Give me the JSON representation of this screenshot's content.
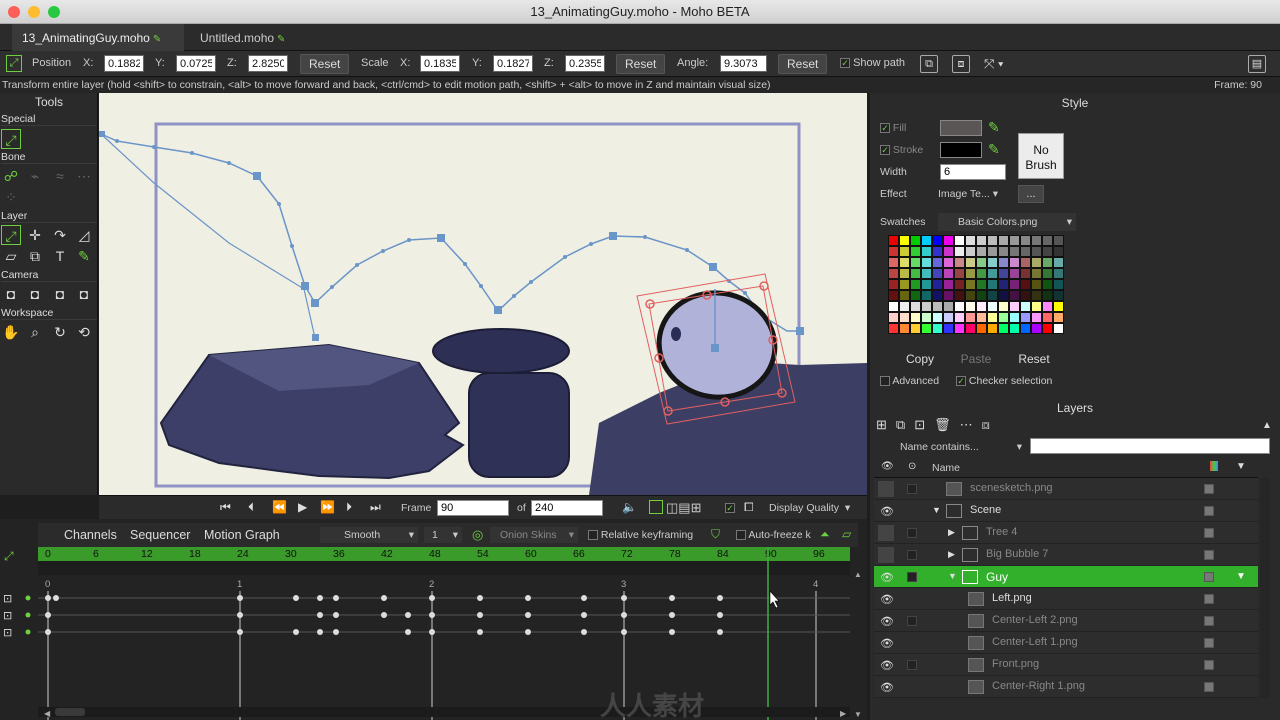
{
  "window": {
    "title": "13_AnimatingGuy.moho - Moho BETA"
  },
  "doc_tabs": [
    {
      "label": "13_AnimatingGuy.moho",
      "active": true
    },
    {
      "label": "Untitled.moho",
      "active": false
    }
  ],
  "options": {
    "position_label": "Position",
    "x_label": "X:",
    "y_label": "Y:",
    "z_label": "Z:",
    "pos_x": "0.1882",
    "pos_y": "0.0725",
    "pos_z": "2.8250",
    "reset_label": "Reset",
    "scale_label": "Scale",
    "scale_x": "0.1835",
    "scale_y": "0.1827",
    "scale_z": "0.2355",
    "angle_label": "Angle:",
    "angle": "9.3073",
    "show_path_label": "Show path"
  },
  "status": {
    "message": "Transform entire layer (hold <shift> to constrain, <alt> to move forward and back, <ctrl/cmd> to edit motion path, <shift> + <alt> to move in Z and maintain visual size)",
    "frame_readout": "Frame: 90"
  },
  "tools": {
    "title": "Tools",
    "groups": [
      "Special",
      "Bone",
      "Layer",
      "Camera",
      "Workspace"
    ]
  },
  "style": {
    "title": "Style",
    "fill_label": "Fill",
    "stroke_label": "Stroke",
    "width_label": "Width",
    "width_value": "6",
    "effect_label": "Effect",
    "effect_value": "Image Te...",
    "effect_more": "...",
    "no_brush_line1": "No",
    "no_brush_line2": "Brush",
    "swatches_label": "Swatches",
    "swatches_value": "Basic Colors.png",
    "copy_label": "Copy",
    "paste_label": "Paste",
    "reset_label": "Reset",
    "advanced_label": "Advanced",
    "checker_label": "Checker selection",
    "fill_color": "#5a5656",
    "stroke_color": "#000000"
  },
  "layers": {
    "title": "Layers",
    "filter_label": "Name contains...",
    "name_header": "Name",
    "items": [
      {
        "name": "scenesketch.png",
        "indent": 0,
        "dim": true,
        "visible": false,
        "arrow": ""
      },
      {
        "name": "Scene",
        "indent": 0,
        "dim": false,
        "visible": true,
        "arrow": "▼"
      },
      {
        "name": "Tree 4",
        "indent": 1,
        "dim": true,
        "visible": false,
        "arrow": "▶"
      },
      {
        "name": "Big Bubble 7",
        "indent": 1,
        "dim": true,
        "visible": false,
        "arrow": "▶"
      },
      {
        "name": "Guy",
        "indent": 1,
        "dim": false,
        "visible": true,
        "arrow": "▼",
        "selected": true
      },
      {
        "name": "Left.png",
        "indent": 2,
        "dim": false,
        "visible": true,
        "arrow": ""
      },
      {
        "name": "Center-Left 2.png",
        "indent": 2,
        "dim": true,
        "visible": true,
        "arrow": ""
      },
      {
        "name": "Center-Left 1.png",
        "indent": 2,
        "dim": true,
        "visible": true,
        "arrow": ""
      },
      {
        "name": "Front.png",
        "indent": 2,
        "dim": true,
        "visible": true,
        "arrow": ""
      },
      {
        "name": "Center-Right 1.png",
        "indent": 2,
        "dim": true,
        "visible": true,
        "arrow": ""
      }
    ]
  },
  "playback": {
    "frame_label": "Frame",
    "frame_value": "90",
    "of_label": "of",
    "total_frames": "240",
    "display_quality": "Display Quality"
  },
  "timeline": {
    "tabs": [
      "Channels",
      "Sequencer",
      "Motion Graph"
    ],
    "interp": "Smooth",
    "interp_num": "1",
    "onion_label": "Onion Skins",
    "relative_label": "Relative keyframing",
    "autofreeze_label": "Auto-freeze k",
    "ruler": [
      "0",
      "6",
      "12",
      "18",
      "24",
      "30",
      "36",
      "42",
      "48",
      "54",
      "60",
      "66",
      "72",
      "78",
      "84",
      "90",
      "96"
    ],
    "seconds": [
      "0",
      "1",
      "2",
      "3",
      "4"
    ],
    "current_frame": 90
  },
  "watermark": "人人素材"
}
